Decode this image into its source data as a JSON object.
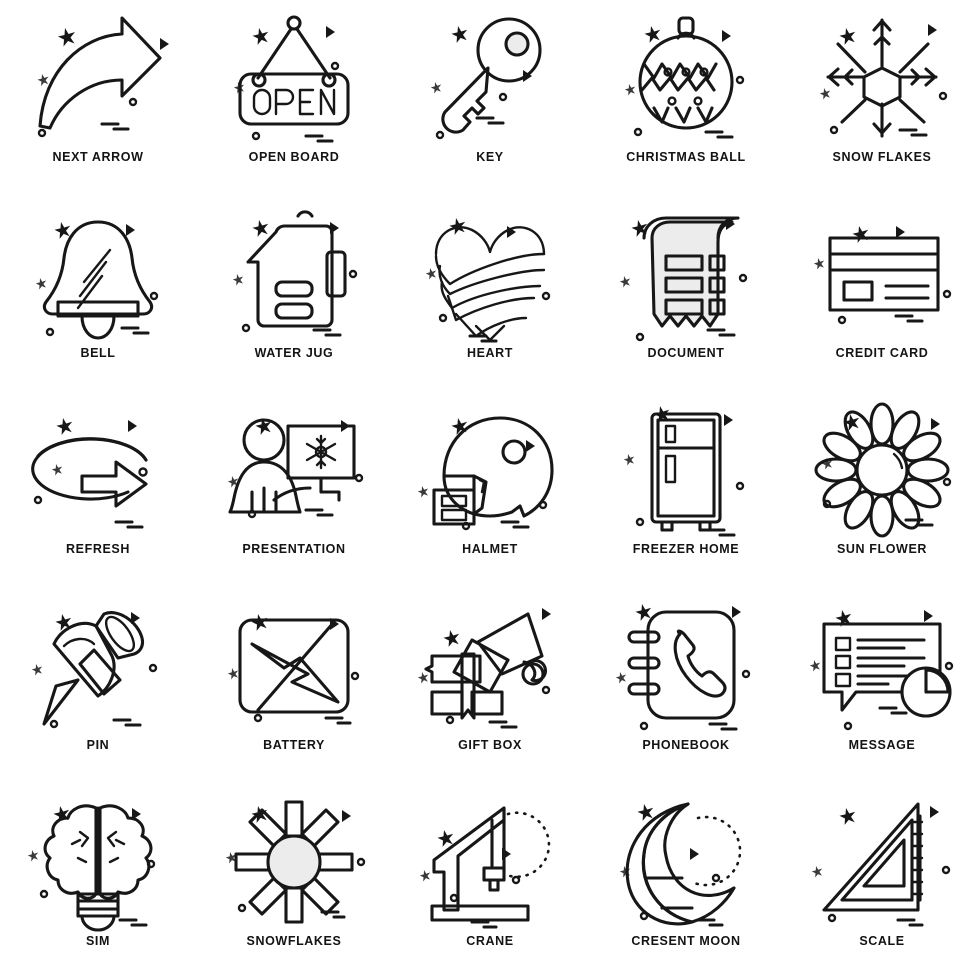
{
  "page": {
    "title": "Icon Set Sheet",
    "background_color": "#ffffff",
    "stroke_color": "#171717",
    "fill_accent_color": "#ececec",
    "columns": 5,
    "rows": 5,
    "style": "line-art-outline-with-sparkle-decorations"
  },
  "decorations": {
    "sparkle": "four-point-star",
    "small_sparkle": "tiny-four-point-star",
    "dot": "small-circle-outline",
    "chevron": "right-pointing-triangle",
    "dash": "short-double-dash"
  },
  "icons": [
    {
      "id": "next-arrow",
      "label": "NEXT ARROW",
      "row": 1,
      "col": 1
    },
    {
      "id": "open-board",
      "label": "OPEN BOARD",
      "row": 1,
      "col": 2,
      "sign_text": "OPEN"
    },
    {
      "id": "key",
      "label": "KEY",
      "row": 1,
      "col": 3
    },
    {
      "id": "christmas-ball",
      "label": "CHRISTMAS BALL",
      "row": 1,
      "col": 4
    },
    {
      "id": "snow-flakes",
      "label": "SNOW FLAKES",
      "row": 1,
      "col": 5
    },
    {
      "id": "bell",
      "label": "BELL",
      "row": 2,
      "col": 1
    },
    {
      "id": "water-jug",
      "label": "WATER JUG",
      "row": 2,
      "col": 2
    },
    {
      "id": "heart",
      "label": "HEART",
      "row": 2,
      "col": 3
    },
    {
      "id": "document",
      "label": "DOCUMENT",
      "row": 2,
      "col": 4
    },
    {
      "id": "credit-card",
      "label": "CREDIT CARD",
      "row": 2,
      "col": 5
    },
    {
      "id": "refresh",
      "label": "REFRESH",
      "row": 3,
      "col": 1
    },
    {
      "id": "presentation",
      "label": "PRESENTATION",
      "row": 3,
      "col": 2
    },
    {
      "id": "halmet",
      "label": "HALMET",
      "row": 3,
      "col": 3
    },
    {
      "id": "freezer-home",
      "label": "FREEZER HOME",
      "row": 3,
      "col": 4
    },
    {
      "id": "sun-flower",
      "label": "SUN FLOWER",
      "row": 3,
      "col": 5
    },
    {
      "id": "pin",
      "label": "PIN",
      "row": 4,
      "col": 1
    },
    {
      "id": "battery",
      "label": "BATTERY",
      "row": 4,
      "col": 2
    },
    {
      "id": "gift-box",
      "label": "GIFT BOX",
      "row": 4,
      "col": 3
    },
    {
      "id": "phonebook",
      "label": "PHONEBOOK",
      "row": 4,
      "col": 4
    },
    {
      "id": "message",
      "label": "MESSAGE",
      "row": 4,
      "col": 5
    },
    {
      "id": "sim",
      "label": "SIM",
      "row": 5,
      "col": 1
    },
    {
      "id": "snowflakes",
      "label": "SNOWFLAKES",
      "row": 5,
      "col": 2
    },
    {
      "id": "crane",
      "label": "CRANE",
      "row": 5,
      "col": 3
    },
    {
      "id": "cresent-moon",
      "label": "CRESENT MOON",
      "row": 5,
      "col": 4
    },
    {
      "id": "scale",
      "label": "SCALE",
      "row": 5,
      "col": 5
    }
  ]
}
